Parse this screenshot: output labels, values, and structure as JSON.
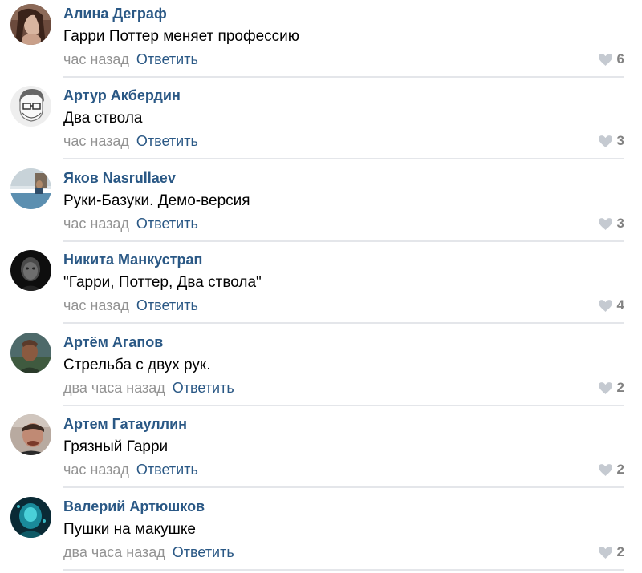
{
  "colors": {
    "author": "#2a5885",
    "reply": "#2a5885",
    "time": "#939393",
    "like_icon": "#c5cad1",
    "like_count": "#828282",
    "divider": "#e4e6ea"
  },
  "comments": [
    {
      "author": "Алина Деграф",
      "text": "Гарри Поттер меняет профессию",
      "time": "час назад",
      "reply": "Ответить",
      "likes": "6",
      "like_icon": "heart-icon"
    },
    {
      "author": "Артур Акбердин",
      "text": "Два ствола",
      "time": "час назад",
      "reply": "Ответить",
      "likes": "3",
      "like_icon": "heart-icon"
    },
    {
      "author": "Яков Nasrullaev",
      "text": "Руки-Базуки. Демо-версия",
      "time": "час назад",
      "reply": "Ответить",
      "likes": "3",
      "like_icon": "heart-icon"
    },
    {
      "author": "Никита Манкустрап",
      "text": "\"Гарри, Поттер, Два ствола\"",
      "time": "час назад",
      "reply": "Ответить",
      "likes": "4",
      "like_icon": "heart-icon"
    },
    {
      "author": "Артём Агапов",
      "text": "Стрельба с двух рук.",
      "time": "два часа назад",
      "reply": "Ответить",
      "likes": "2",
      "like_icon": "heart-icon"
    },
    {
      "author": "Артем Гатауллин",
      "text": "Грязный Гарри",
      "time": "час назад",
      "reply": "Ответить",
      "likes": "2",
      "like_icon": "heart-icon"
    },
    {
      "author": "Валерий Артюшков",
      "text": "Пушки на макушке",
      "time": "два часа назад",
      "reply": "Ответить",
      "likes": "2",
      "like_icon": "heart-icon"
    }
  ]
}
